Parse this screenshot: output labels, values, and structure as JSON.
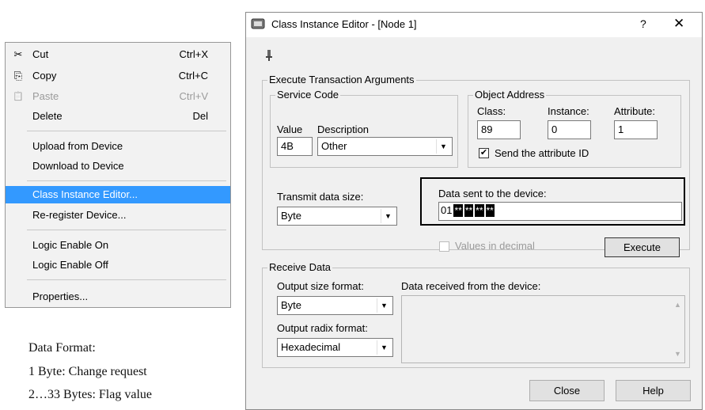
{
  "context_menu": {
    "items": [
      {
        "icon": "scissors-icon",
        "glyph": "✂",
        "label": "Cut",
        "shortcut": "Ctrl+X"
      },
      {
        "icon": "copy-icon",
        "glyph": "⎘",
        "label": "Copy",
        "shortcut": "Ctrl+C"
      },
      {
        "icon": "paste-icon",
        "glyph": "📋",
        "label": "Paste",
        "shortcut": "Ctrl+V",
        "disabled": true
      },
      {
        "label": "Delete",
        "shortcut": "Del"
      },
      {
        "label": "Upload from Device"
      },
      {
        "label": "Download to Device"
      },
      {
        "label": "Class Instance Editor...",
        "highlighted": true
      },
      {
        "label": "Re-register Device..."
      },
      {
        "label": "Logic Enable On"
      },
      {
        "label": "Logic Enable Off"
      },
      {
        "label": "Properties..."
      }
    ]
  },
  "notes": {
    "line1": "Data Format:",
    "line2": "1 Byte: Change request",
    "line3": "2…33 Bytes: Flag value"
  },
  "dialog": {
    "title": "Class Instance Editor - [Node 1]",
    "help_glyph": "?",
    "close_glyph": "✕",
    "execute_args": {
      "group_label": "Execute Transaction Arguments",
      "service_code": {
        "group_label": "Service Code",
        "value_label": "Value",
        "value": "4B",
        "description_label": "Description",
        "description": "Other"
      },
      "object_address": {
        "group_label": "Object Address",
        "class_label": "Class:",
        "class_value": "89",
        "instance_label": "Instance:",
        "instance_value": "0",
        "attribute_label": "Attribute:",
        "attribute_value": "1",
        "send_attr_label": "Send the attribute ID",
        "send_attr_checked": true
      },
      "transmit_size_label": "Transmit data size:",
      "transmit_size": "Byte",
      "data_sent_label": "Data sent to the device:",
      "data_sent_first": "01",
      "data_sent_masked": [
        "**",
        "**",
        "**",
        "**"
      ],
      "values_decimal_label": "Values in decimal",
      "execute_button": "Execute"
    },
    "receive": {
      "group_label": "Receive Data",
      "output_size_label": "Output size format:",
      "output_size": "Byte",
      "output_radix_label": "Output radix format:",
      "output_radix": "Hexadecimal",
      "data_received_label": "Data received from the device:"
    },
    "close_button": "Close",
    "help_button": "Help"
  }
}
